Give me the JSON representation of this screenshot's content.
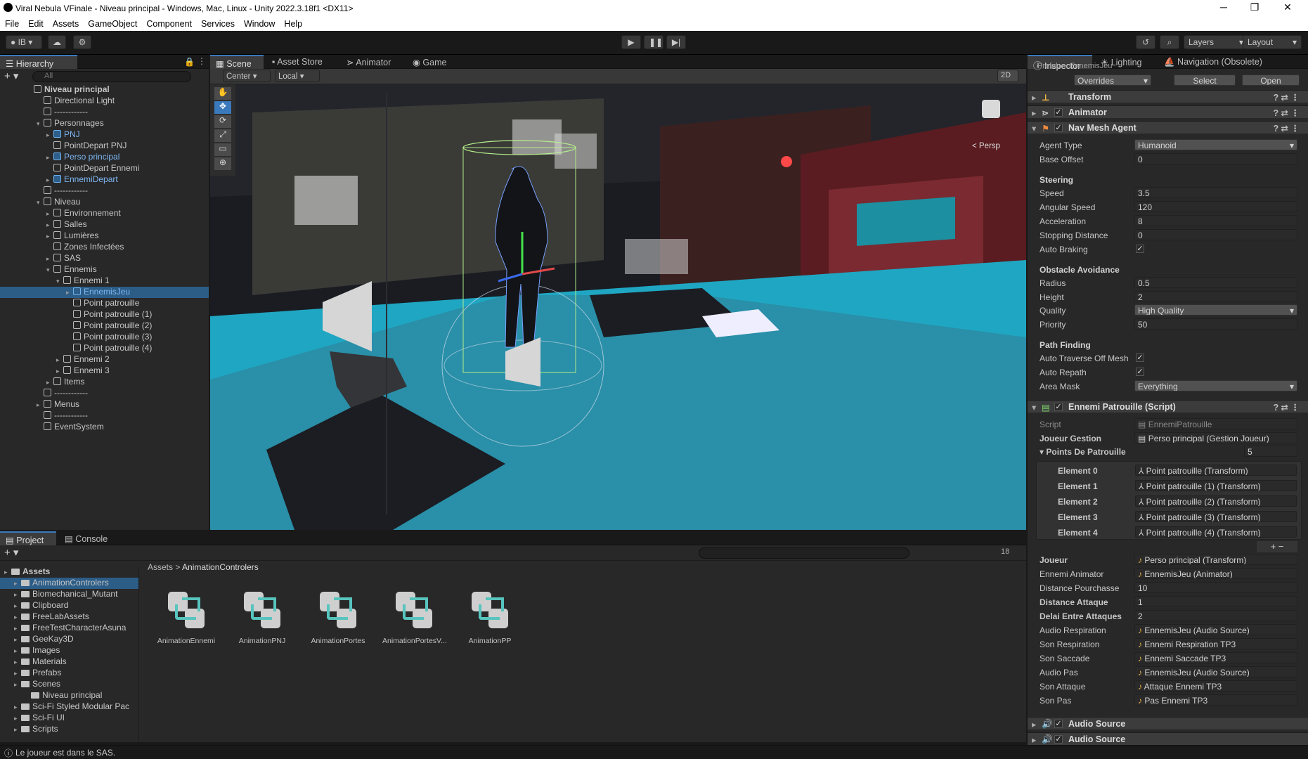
{
  "window": {
    "title": "Viral Nebula VFinale - Niveau principal - Windows, Mac, Linux - Unity 2022.3.18f1 <DX11>",
    "minimize": "─",
    "maximize": "❐",
    "close": "✕"
  },
  "menu": [
    "File",
    "Edit",
    "Assets",
    "GameObject",
    "Component",
    "Services",
    "Window",
    "Help"
  ],
  "toolbar": {
    "account": "IB",
    "layers": "Layers",
    "layout": "Layout"
  },
  "hierarchy": {
    "tab": "Hierarchy",
    "search_placeholder": "All",
    "rows": [
      {
        "t": "Niveau principal",
        "d": 0,
        "bold": true
      },
      {
        "t": "Directional Light",
        "d": 1
      },
      {
        "t": "------------",
        "d": 1
      },
      {
        "t": "Personnages",
        "d": 1,
        "exp": "v"
      },
      {
        "t": "PNJ",
        "d": 2,
        "prefab": true,
        "exp": ">"
      },
      {
        "t": "PointDepart PNJ",
        "d": 2
      },
      {
        "t": "Perso principal",
        "d": 2,
        "prefab": true,
        "exp": ">"
      },
      {
        "t": "PointDepart Ennemi",
        "d": 2
      },
      {
        "t": "EnnemiDepart",
        "d": 2,
        "prefab": true,
        "exp": ">"
      },
      {
        "t": "------------",
        "d": 1
      },
      {
        "t": "Niveau",
        "d": 1,
        "exp": "v"
      },
      {
        "t": "Environnement",
        "d": 2,
        "exp": ">"
      },
      {
        "t": "Salles",
        "d": 2,
        "exp": ">"
      },
      {
        "t": "Lumières",
        "d": 2,
        "exp": ">"
      },
      {
        "t": "Zones Infectées",
        "d": 2
      },
      {
        "t": "SAS",
        "d": 2,
        "exp": ">"
      },
      {
        "t": "Ennemis",
        "d": 2,
        "exp": "v"
      },
      {
        "t": "Ennemi 1",
        "d": 3,
        "exp": "v"
      },
      {
        "t": "EnnemisJeu",
        "d": 4,
        "prefab": true,
        "exp": ">",
        "sel": true
      },
      {
        "t": "Point patrouille",
        "d": 4
      },
      {
        "t": "Point patrouille (1)",
        "d": 4
      },
      {
        "t": "Point patrouille (2)",
        "d": 4
      },
      {
        "t": "Point patrouille (3)",
        "d": 4
      },
      {
        "t": "Point patrouille (4)",
        "d": 4
      },
      {
        "t": "Ennemi 2",
        "d": 3,
        "exp": ">"
      },
      {
        "t": "Ennemi 3",
        "d": 3,
        "exp": ">"
      },
      {
        "t": "Items",
        "d": 2,
        "exp": ">"
      },
      {
        "t": "------------",
        "d": 1
      },
      {
        "t": "Menus",
        "d": 1,
        "exp": ">"
      },
      {
        "t": "------------",
        "d": 1
      },
      {
        "t": "EventSystem",
        "d": 1
      }
    ]
  },
  "scene": {
    "tabs": [
      "Scene",
      "Asset Store",
      "Animator",
      "Game"
    ],
    "pivot": "Center",
    "space": "Local",
    "mode2d": "2D",
    "persp": "< Persp"
  },
  "inspector": {
    "tabs": [
      "Inspector",
      "Lighting",
      "Navigation (Obsolete)"
    ],
    "prefab_label": "Prefab",
    "prefab_name": "EnnemisJeu",
    "overrides": "Overrides",
    "select": "Select",
    "open": "Open",
    "components": {
      "transform": "Transform",
      "animator": "Animator",
      "navmesh": "Nav Mesh Agent",
      "script": "Ennemi Patrouille (Script)",
      "audio1": "Audio Source",
      "audio2": "Audio Source"
    },
    "nav": {
      "agent_type_l": "Agent Type",
      "agent_type": "Humanoid",
      "base_offset_l": "Base Offset",
      "base_offset": "0",
      "steering": "Steering",
      "speed_l": "Speed",
      "speed": "3.5",
      "ang_l": "Angular Speed",
      "ang": "120",
      "acc_l": "Acceleration",
      "acc": "8",
      "stop_l": "Stopping Distance",
      "stop": "0",
      "brake_l": "Auto Braking",
      "obstacle": "Obstacle Avoidance",
      "radius_l": "Radius",
      "radius": "0.5",
      "height_l": "Height",
      "height": "2",
      "quality_l": "Quality",
      "quality": "High Quality",
      "priority_l": "Priority",
      "priority": "50",
      "path": "Path Finding",
      "traverse_l": "Auto Traverse Off Mesh",
      "repath_l": "Auto Repath",
      "mask_l": "Area Mask",
      "mask": "Everything"
    },
    "script": {
      "script_l": "Script",
      "script": "EnnemiPatrouille",
      "joueur_gestion_l": "Joueur Gestion",
      "joueur_gestion": "Perso principal (Gestion Joueur)",
      "points_l": "Points De Patrouille",
      "points_count": "5",
      "elements": [
        {
          "l": "Element 0",
          "v": "Point patrouille (Transform)"
        },
        {
          "l": "Element 1",
          "v": "Point patrouille (1) (Transform)"
        },
        {
          "l": "Element 2",
          "v": "Point patrouille (2) (Transform)"
        },
        {
          "l": "Element 3",
          "v": "Point patrouille (3) (Transform)"
        },
        {
          "l": "Element 4",
          "v": "Point patrouille (4) (Transform)"
        }
      ],
      "fields": [
        {
          "l": "Joueur",
          "v": "Perso principal (Transform)",
          "bold": true
        },
        {
          "l": "Ennemi Animator",
          "v": "EnnemisJeu (Animator)"
        },
        {
          "l": "Distance Pourchasse",
          "v": "10",
          "plain": true
        },
        {
          "l": "Distance Attaque",
          "v": "1",
          "plain": true,
          "bold": true
        },
        {
          "l": "Delai Entre Attaques",
          "v": "2",
          "plain": true,
          "bold": true
        },
        {
          "l": "Audio Respiration",
          "v": "EnnemisJeu (Audio Source)"
        },
        {
          "l": "Son Respiration",
          "v": "Ennemi Respiration TP3"
        },
        {
          "l": "Son Saccade",
          "v": "Ennemi Saccade TP3"
        },
        {
          "l": "Audio Pas",
          "v": "EnnemisJeu (Audio Source)"
        },
        {
          "l": "Son Attaque",
          "v": "Attaque Ennemi TP3"
        },
        {
          "l": "Son Pas",
          "v": "Pas Ennemi TP3"
        }
      ]
    }
  },
  "project": {
    "tabs": [
      "Project",
      "Console"
    ],
    "breadcrumb_root": "Assets",
    "breadcrumb_child": "AnimationControlers",
    "hidden_count": "18",
    "tree": [
      {
        "t": "Assets",
        "d": 0,
        "bold": true
      },
      {
        "t": "AnimationControlers",
        "d": 1,
        "sel": true
      },
      {
        "t": "Biomechanical_Mutant",
        "d": 1
      },
      {
        "t": "Clipboard",
        "d": 1
      },
      {
        "t": "FreeLabAssets",
        "d": 1
      },
      {
        "t": "FreeTestCharacterAsuna",
        "d": 1
      },
      {
        "t": "GeeKay3D",
        "d": 1
      },
      {
        "t": "Images",
        "d": 1
      },
      {
        "t": "Materials",
        "d": 1
      },
      {
        "t": "Prefabs",
        "d": 1
      },
      {
        "t": "Scenes",
        "d": 1
      },
      {
        "t": "Niveau principal",
        "d": 2
      },
      {
        "t": "Sci-Fi Styled Modular Pac",
        "d": 1
      },
      {
        "t": "Sci-Fi UI",
        "d": 1
      },
      {
        "t": "Scripts",
        "d": 1
      }
    ],
    "assets": [
      "AnimationEnnemi",
      "AnimationPNJ",
      "AnimationPortes",
      "AnimationPortesV...",
      "AnimationPP"
    ]
  },
  "status": {
    "message": "Le joueur est dans le SAS."
  },
  "colors": {
    "accent": "#3a79bb",
    "prefab": "#7cb6f2",
    "teal": "#1fa6c2"
  }
}
